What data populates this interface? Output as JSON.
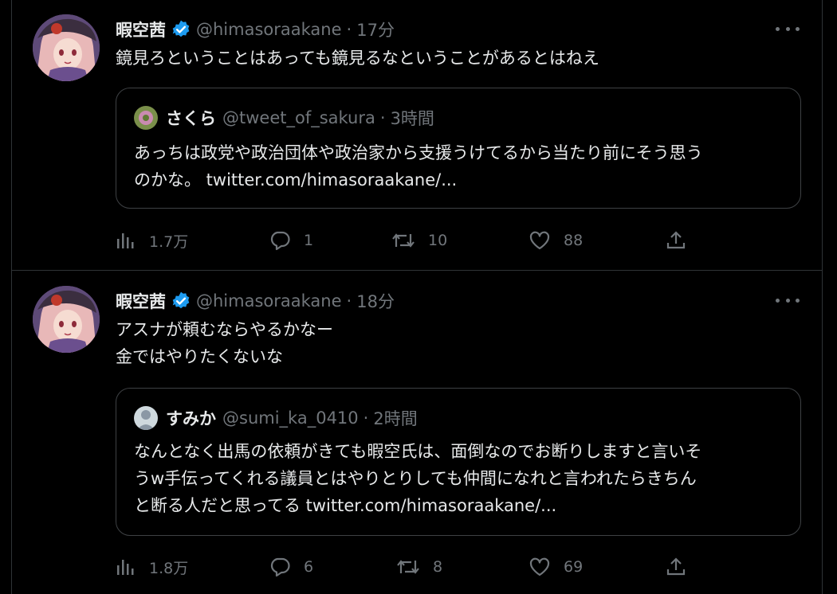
{
  "tweets": [
    {
      "author": {
        "name": "暇空茜",
        "handle": "@himasoraakane",
        "time": "17分"
      },
      "lines": [
        "鏡見ろということはあっても鏡見るなということがあるとはねえ"
      ],
      "quote": {
        "name": "さくら",
        "handle": "@tweet_of_sakura",
        "time": "3時間",
        "lines": [
          "あっちは政党や政治団体や政治家から支援うけてるから当たり前にそう思う",
          "のかな。 twitter.com/himasoraakane/..."
        ]
      },
      "stats": {
        "views": "1.7万",
        "replies": "1",
        "retweets": "10",
        "likes": "88"
      }
    },
    {
      "author": {
        "name": "暇空茜",
        "handle": "@himasoraakane",
        "time": "18分"
      },
      "lines": [
        "アスナが頼むならやるかなー",
        "金ではやりたくないな"
      ],
      "quote": {
        "name": "すみか",
        "handle": "@sumi_ka_0410",
        "time": "2時間",
        "lines": [
          "なんとなく出馬の依頼がきても暇空氏は、面倒なのでお断りしますと言いそ",
          "うw手伝ってくれる議員とはやりとりしても仲間になれと言われたらきちん",
          "と断る人だと思ってる twitter.com/himasoraakane/..."
        ]
      },
      "stats": {
        "views": "1.8万",
        "replies": "6",
        "retweets": "8",
        "likes": "69"
      }
    }
  ],
  "icons": {
    "verified": "verified-badge-icon",
    "more": "more-dots-icon",
    "views": "bar-chart-icon",
    "reply": "speech-bubble-icon",
    "retweet": "retweet-arrows-icon",
    "like": "heart-icon",
    "share": "share-upload-icon"
  },
  "colors": {
    "background": "#000000",
    "text": "#e7e9ea",
    "muted": "#71767b",
    "verified": "#1d9bf0",
    "border": "#2f3336"
  }
}
